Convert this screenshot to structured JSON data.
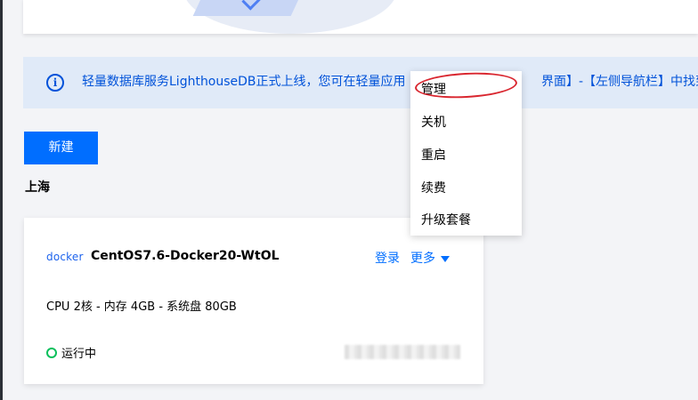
{
  "notice": {
    "text": "轻量数据库服务LighthouseDB正式上线，您可在轻量应用",
    "text_right": "界面】-【左侧导航栏】中找到新"
  },
  "toolbar": {
    "create_label": "新建"
  },
  "region": {
    "title": "上海"
  },
  "instance": {
    "logo": "docker",
    "name": "CentOS7.6-Docker20-WtOL",
    "login_label": "登录",
    "more_label": "更多",
    "spec": "CPU 2核 - 内存 4GB - 系统盘 80GB",
    "status": "运行中"
  },
  "dropdown": {
    "items": [
      "管理",
      "关机",
      "重启",
      "续费",
      "升级套餐"
    ]
  },
  "colors": {
    "accent": "#006eff",
    "status_running": "#0abf5b",
    "notice_bg": "#e0eaf8",
    "annotation": "#d9262f"
  }
}
